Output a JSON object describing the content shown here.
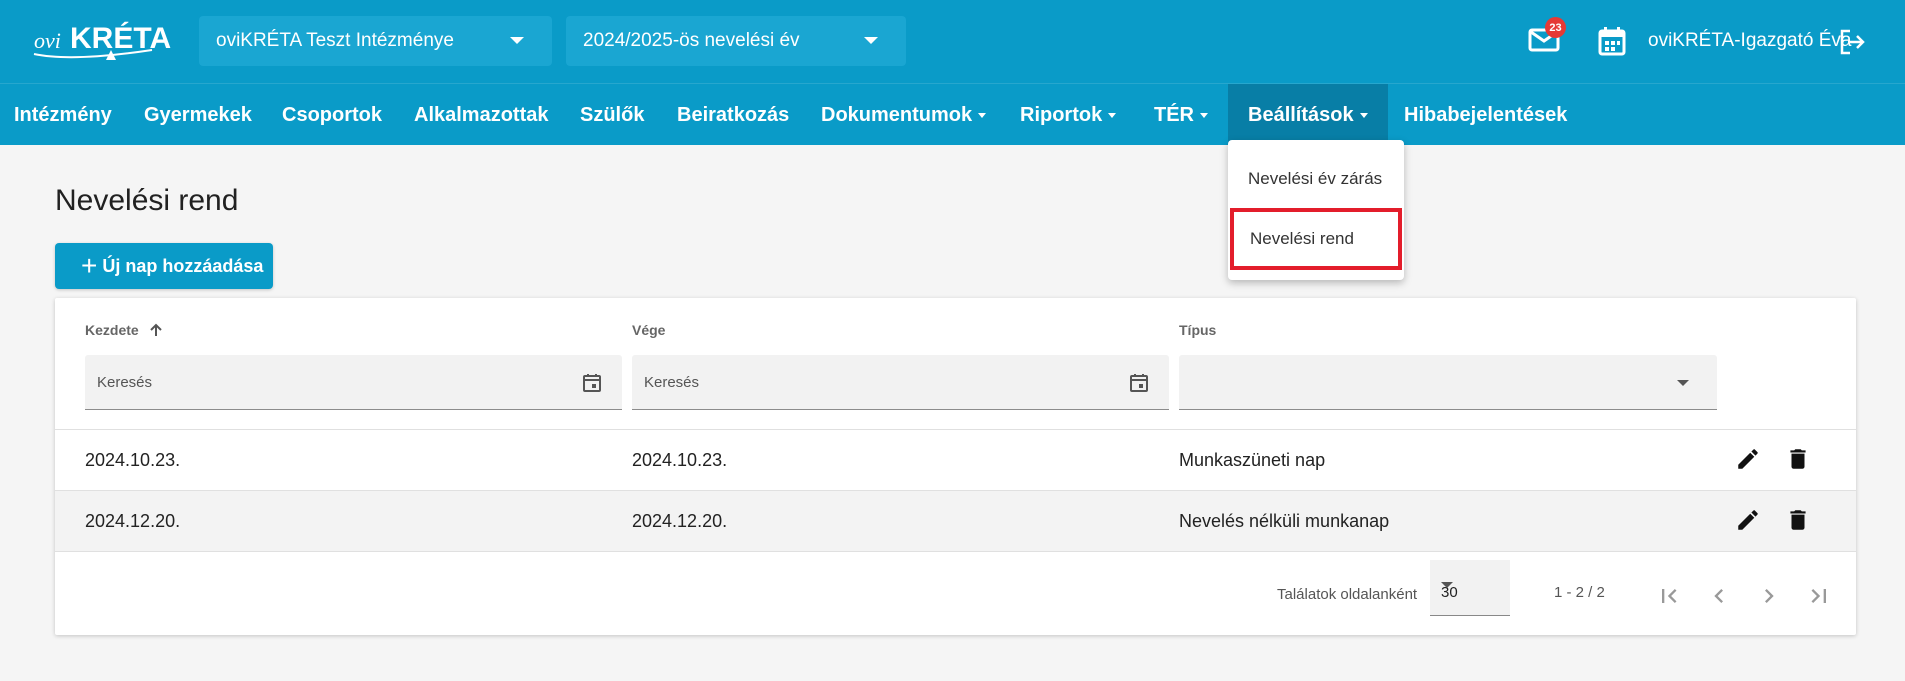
{
  "header": {
    "logo_text": "oviKRÉTA",
    "institution": "oviKRÉTA Teszt Intézménye",
    "school_year": "2024/2025-ös nevelési év",
    "mail_badge": "23",
    "user_name": "oviKRÉTA-Igazgató Éva"
  },
  "nav": {
    "items": [
      {
        "label": "Intézmény"
      },
      {
        "label": "Gyermekek"
      },
      {
        "label": "Csoportok"
      },
      {
        "label": "Alkalmazottak"
      },
      {
        "label": "Szülők"
      },
      {
        "label": "Beiratkozás"
      },
      {
        "label": "Dokumentumok"
      },
      {
        "label": "Riportok"
      },
      {
        "label": "TÉR"
      },
      {
        "label": "Beállítások"
      },
      {
        "label": "Hibabejelentések"
      }
    ],
    "dropdown": [
      "Nevelési év zárás",
      "Nevelési rend"
    ]
  },
  "page": {
    "title": "Nevelési rend",
    "add_button": "Új nap hozzáadása"
  },
  "table": {
    "columns": [
      "Kezdete",
      "Vége",
      "Típus"
    ],
    "search_placeholder": "Keresés",
    "rows": [
      {
        "start": "2024.10.23.",
        "end": "2024.10.23.",
        "type": "Munkaszüneti nap"
      },
      {
        "start": "2024.12.20.",
        "end": "2024.12.20.",
        "type": "Nevelés nélküli munkanap"
      }
    ],
    "footer": {
      "per_page_label": "Találatok oldalanként",
      "per_page_value": "30",
      "range": "1 - 2 / 2"
    }
  },
  "colors": {
    "primary": "#0a9bc8",
    "nav_active": "#087ea6",
    "highlight_border": "#e31d2b",
    "badge": "#e53935"
  }
}
